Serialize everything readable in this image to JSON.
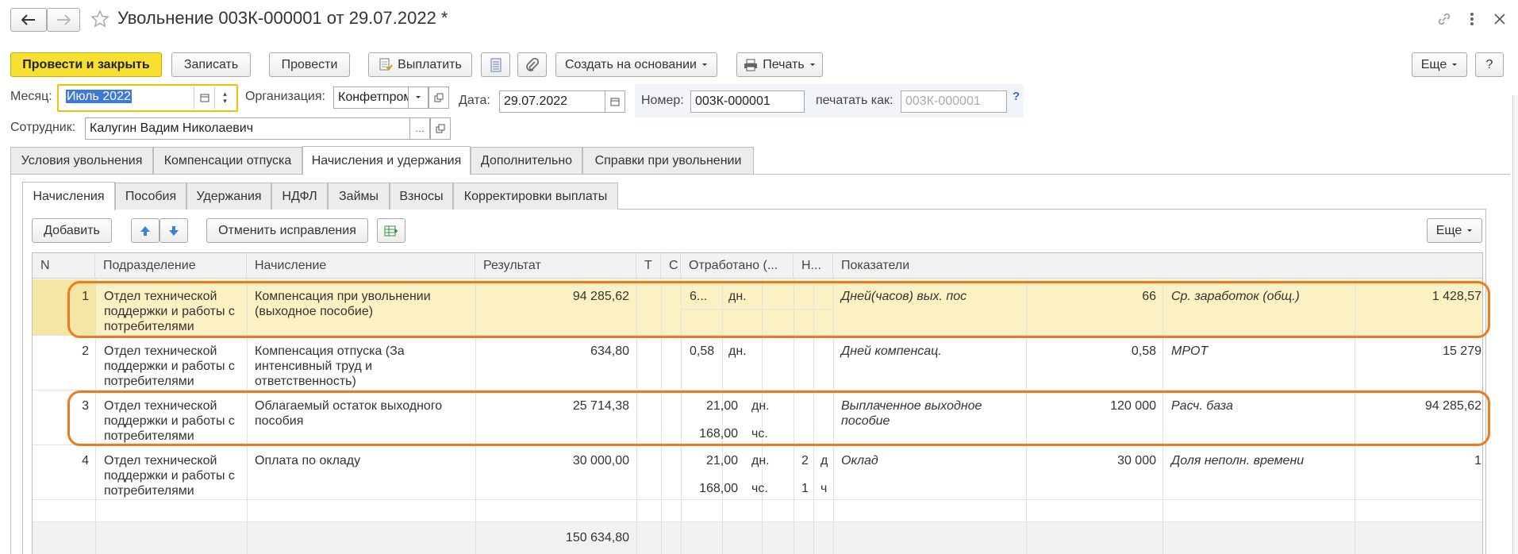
{
  "header": {
    "title": "Увольнение 003К-000001 от 29.07.2022 *"
  },
  "toolbar": {
    "post_close": "Провести и закрыть",
    "save": "Записать",
    "post": "Провести",
    "pay": "Выплатить",
    "create_based": "Создать на основании",
    "print": "Печать",
    "more": "Еще",
    "help": "?"
  },
  "form": {
    "month_label": "Месяц:",
    "month_value": "Июль 2022",
    "org_label": "Организация:",
    "org_value": "Конфетпром",
    "date_label": "Дата:",
    "date_value": "29.07.2022",
    "number_label": "Номер:",
    "number_value": "003К-000001",
    "print_as_label": "печатать как:",
    "print_as_placeholder": "003К-000001",
    "employee_label": "Сотрудник:",
    "employee_value": "Калугин Вадим Николаевич"
  },
  "tabs": [
    "Условия увольнения",
    "Компенсации отпуска",
    "Начисления и удержания",
    "Дополнительно",
    "Справки при увольнении"
  ],
  "subtabs": [
    "Начисления",
    "Пособия",
    "Удержания",
    "НДФЛ",
    "Займы",
    "Взносы",
    "Корректировки выплаты"
  ],
  "grid_toolbar": {
    "add": "Добавить",
    "cancel_fixes": "Отменить исправления",
    "more": "Еще"
  },
  "columns": [
    "N",
    "Подразделение",
    "Начисление",
    "Результат",
    "Т",
    "С",
    "Отработано (...",
    "Н...",
    "Показатели"
  ],
  "rows": [
    {
      "n": "1",
      "dept": [
        "Отдел технической",
        "поддержки и работы с",
        "потребителями"
      ],
      "accrual": [
        "Компенсация при увольнении",
        "(выходное пособие)"
      ],
      "result": "94 285,62",
      "worked1": "6...",
      "unit1": "дн.",
      "worked2": "",
      "unit2": "",
      "n1": "",
      "n1b": "",
      "n2": "",
      "n2b": "",
      "ind1_name": "Дней(часов) вых. пос",
      "ind1_val": "66",
      "ind2_name": "Ср. заработок (общ.)",
      "ind2_val": "1 428,57"
    },
    {
      "n": "2",
      "dept": [
        "Отдел технической",
        "поддержки и работы с",
        "потребителями"
      ],
      "accrual": [
        "Компенсация отпуска (За",
        "интенсивный труд и",
        "ответственность)"
      ],
      "result": "634,80",
      "worked1": "0,58",
      "unit1": "дн.",
      "worked2": "",
      "unit2": "",
      "n1": "",
      "n1b": "",
      "n2": "",
      "n2b": "",
      "ind1_name": "Дней компенсац.",
      "ind1_val": "0,58",
      "ind2_name": "МРОТ",
      "ind2_val": "15 279"
    },
    {
      "n": "3",
      "dept": [
        "Отдел технической",
        "поддержки и работы с",
        "потребителями"
      ],
      "accrual": [
        "Облагаемый остаток выходного",
        "пособия"
      ],
      "result": "25 714,38",
      "worked1": "21,00",
      "unit1": "дн.",
      "worked2": "168,00",
      "unit2": "чс.",
      "n1": "",
      "n1b": "",
      "n2": "",
      "n2b": "",
      "ind1_name": "Выплаченное выходное",
      "ind1_name2": "пособие",
      "ind1_val": "120 000",
      "ind2_name": "Расч. база",
      "ind2_val": "94 285,62"
    },
    {
      "n": "4",
      "dept": [
        "Отдел технической",
        "поддержки и работы с",
        "потребителями"
      ],
      "accrual": [
        "Оплата по окладу"
      ],
      "result": "30 000,00",
      "worked1": "21,00",
      "unit1": "дн.",
      "worked2": "168,00",
      "unit2": "чс.",
      "n1": "2",
      "n1b": "д",
      "n2": "1",
      "n2b": "ч",
      "ind1_name": "Оклад",
      "ind1_val": "30 000",
      "ind2_name": "Доля неполн. времени",
      "ind2_val": "1"
    }
  ],
  "total": "150 634,80"
}
